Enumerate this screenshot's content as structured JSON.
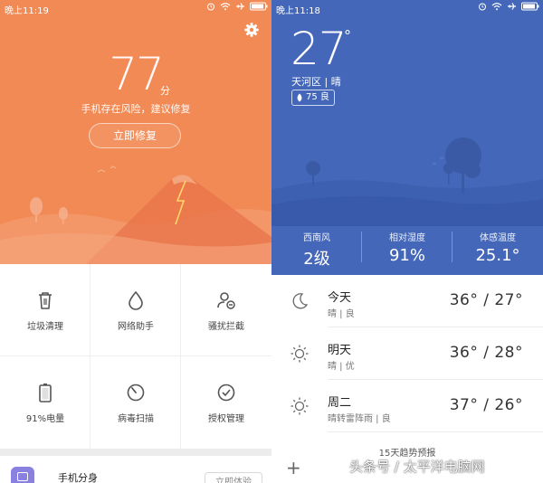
{
  "security_app": {
    "status_bar": {
      "time": "晚上11:19"
    },
    "score": "77",
    "score_unit": "分",
    "warning": "手机存在风险，建议修复",
    "fix_button": "立即修复",
    "tools": [
      {
        "label": "垃圾清理",
        "icon": "trash-icon"
      },
      {
        "label": "网络助手",
        "icon": "drop-icon"
      },
      {
        "label": "骚扰拦截",
        "icon": "block-user-icon"
      },
      {
        "label": "91%电量",
        "icon": "battery-icon"
      },
      {
        "label": "病毒扫描",
        "icon": "scan-icon"
      },
      {
        "label": "授权管理",
        "icon": "check-circle-icon"
      }
    ],
    "dual_app": {
      "title": "手机分身",
      "button": "立即体验"
    },
    "colors": {
      "hero": "#f28a55"
    }
  },
  "weather_app": {
    "status_bar": {
      "time": "晚上11:18"
    },
    "temperature": "27",
    "degree": "°",
    "location": "天河区 | 晴",
    "aqi": "75 良",
    "stats": [
      {
        "label": "西南风",
        "value": "2级"
      },
      {
        "label": "相对湿度",
        "value": "91%"
      },
      {
        "label": "体感温度",
        "value": "25.1°"
      }
    ],
    "forecast": [
      {
        "day": "今天",
        "sub": "晴 | 良",
        "range": "36° / 27°",
        "icon": "moon-icon"
      },
      {
        "day": "明天",
        "sub": "晴 | 优",
        "range": "36° / 28°",
        "icon": "sun-icon"
      },
      {
        "day": "周二",
        "sub": "晴转雷阵雨 | 良",
        "range": "37° / 26°",
        "icon": "sun-icon"
      }
    ],
    "trend_label": "15天趋势预报",
    "add_label": "+",
    "colors": {
      "hero": "#4467b9"
    }
  },
  "watermark": "头条号 / 太平洋电脑网"
}
